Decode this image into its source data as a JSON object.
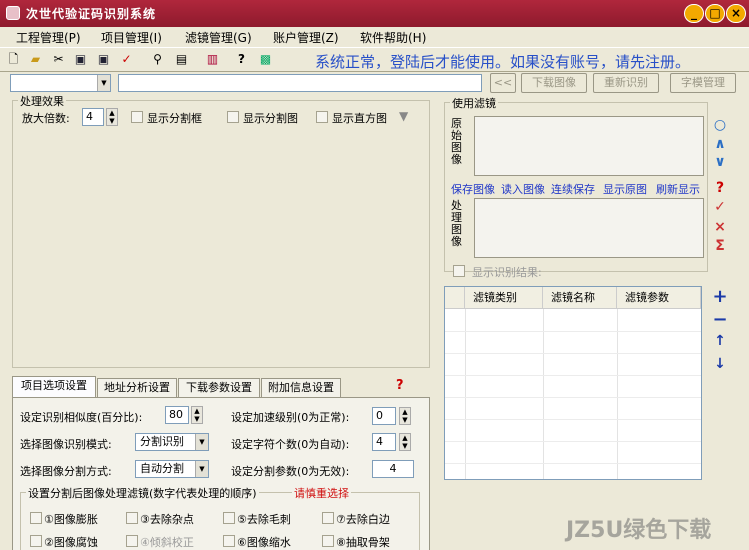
{
  "window": {
    "title": "次世代验证码识别系统",
    "min": "_",
    "max": "□",
    "close": "×"
  },
  "menu": [
    {
      "label": "工程管理(P)"
    },
    {
      "label": "项目管理(I)"
    },
    {
      "label": "滤镜管理(G)"
    },
    {
      "label": "账户管理(Z)"
    },
    {
      "label": "软件帮助(H)"
    }
  ],
  "toolbar": {
    "status": "系统正常，登陆后才能使用。如果没有账号，请先注册。"
  },
  "action_bar": {
    "combo_value": "",
    "url_value": "",
    "back_label": "<<",
    "download_label": "下载图像",
    "reidentify_label": "重新识别",
    "font_manage_label": "字模管理"
  },
  "processing": {
    "group_label": "处理效果",
    "zoom_label": "放大倍数:",
    "zoom_value": "4",
    "show_split_box": "显示分割框",
    "show_split_image": "显示分割图",
    "show_histogram": "显示直方图"
  },
  "filters": {
    "group_label": "使用滤镜",
    "original_label": "原始图像",
    "processed_label": "处理图像",
    "links": [
      "保存图像",
      "读入图像",
      "连续保存",
      "显示原图",
      "刷新显示"
    ],
    "show_result": "显示识别结果:",
    "columns": [
      "滤镜类别",
      "滤镜名称",
      "滤镜参数"
    ]
  },
  "tabs": [
    {
      "label": "项目选项设置"
    },
    {
      "label": "地址分析设置"
    },
    {
      "label": "下载参数设置"
    },
    {
      "label": "附加信息设置"
    }
  ],
  "help_mark": "?",
  "settings": {
    "similarity_label": "设定识别相似度(百分比):",
    "similarity_value": "80",
    "speed_label": "设定加速级别(0为正常):",
    "speed_value": "0",
    "mode_label": "选择图像识别模式:",
    "mode_value": "分割识别",
    "char_count_label": "设定字符个数(0为自动):",
    "char_count_value": "4",
    "split_label": "选择图像分割方式:",
    "split_value": "自动分割",
    "split_param_label": "设定分割参数(0为无效):",
    "split_param_value": "4",
    "post_filter_label": "设置分割后图像处理滤镜(数字代表处理的顺序)",
    "reselect_label": "请慎重选择",
    "options": [
      "①图像膨胀",
      "③去除杂点",
      "⑤去除毛刺",
      "⑦去除白边",
      "②图像腐蚀",
      "④倾斜校正",
      "⑥图像缩水",
      "⑧抽取骨架"
    ]
  },
  "watermark": "JZ5U绿色下载"
}
